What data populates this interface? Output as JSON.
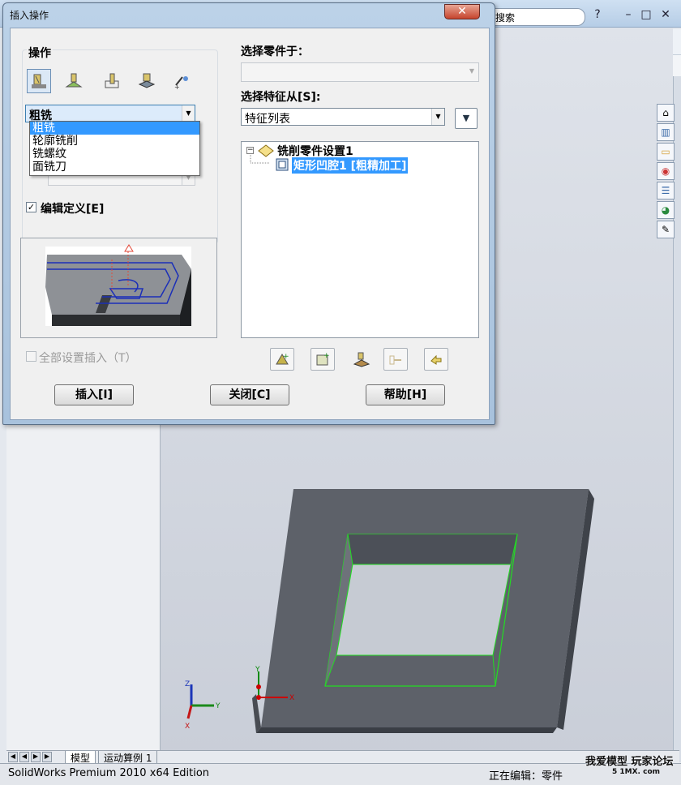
{
  "app": {
    "search_text": "搜索",
    "help_glyph": "?",
    "status_left": "SolidWorks Premium 2010 x64 Edition",
    "status_right": "正在编辑：零件",
    "tabs": [
      "模型",
      "运动算例 1"
    ],
    "watermark": "我爱模型 玩家论坛",
    "watermark_small": "5 1MX. com",
    "task_pane_icons": [
      "home-icon",
      "resources-icon",
      "folder-icon",
      "view-palette-icon",
      "explorer-icon",
      "appearance-icon",
      "custom-properties-icon"
    ]
  },
  "dialog": {
    "title": "插入操作",
    "close_glyph": "✕",
    "operation_group_label": "操作",
    "operation_icons": [
      "rough-mill-icon",
      "contour-mill-icon",
      "thread-mill-icon",
      "face-mill-icon",
      "drill-icon"
    ],
    "operation_select_value": "粗铣",
    "operation_options": [
      "粗铣",
      "轮廓铣削",
      "铣螺纹",
      "面铣刀"
    ],
    "edit_definition_label": "编辑定义[E]",
    "edit_definition_checked": true,
    "insert_all_label": "全部设置插入（T）",
    "insert_all_checked": false,
    "select_part_label": "选择零件于：",
    "select_part_value": "",
    "select_feature_label": "选择特征从[S]:",
    "select_feature_value": "特征列表",
    "tree": {
      "root": "铣削零件设置1",
      "child": "矩形凹腔1 [粗精加工]"
    },
    "buttons": {
      "insert": "插入[I]",
      "close": "关闭[C]",
      "help": "帮助[H]"
    }
  },
  "colors": {
    "selection": "#3399ff",
    "part_face": "#5d6169",
    "edge_highlight": "#22dd22"
  }
}
